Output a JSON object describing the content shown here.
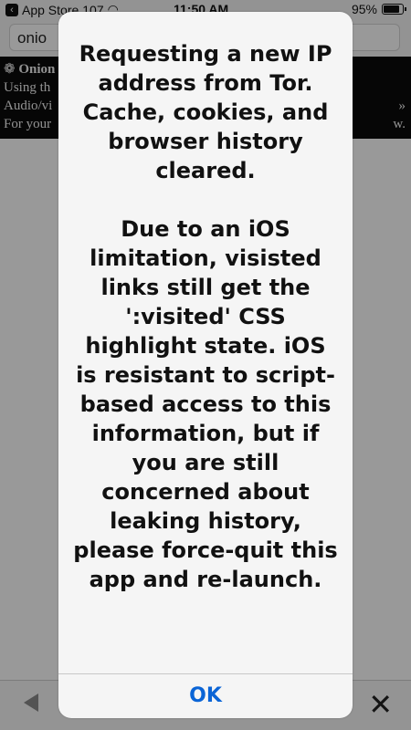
{
  "status_bar": {
    "back_app": "App Store",
    "signal_partial": "107",
    "time": "11:50 AM",
    "battery_percent": "95%"
  },
  "url_bar": {
    "value": "onio"
  },
  "banner": {
    "line1": "Onion",
    "line2": "Using th",
    "line3": "Audio/vi",
    "line4": "For your",
    "right2": "»",
    "right3": "w."
  },
  "alert": {
    "message": "Requesting a new IP address from Tor. Cache, cookies, and browser history cleared.\n\nDue to an iOS limitation, visisted links still get the ':visited' CSS highlight state. iOS is resistant to script-based access to this information, but if you are still concerned about leaking history, please force-quit this app and re-launch.",
    "ok_label": "OK"
  },
  "toolbar": {
    "close_glyph": "✕"
  }
}
